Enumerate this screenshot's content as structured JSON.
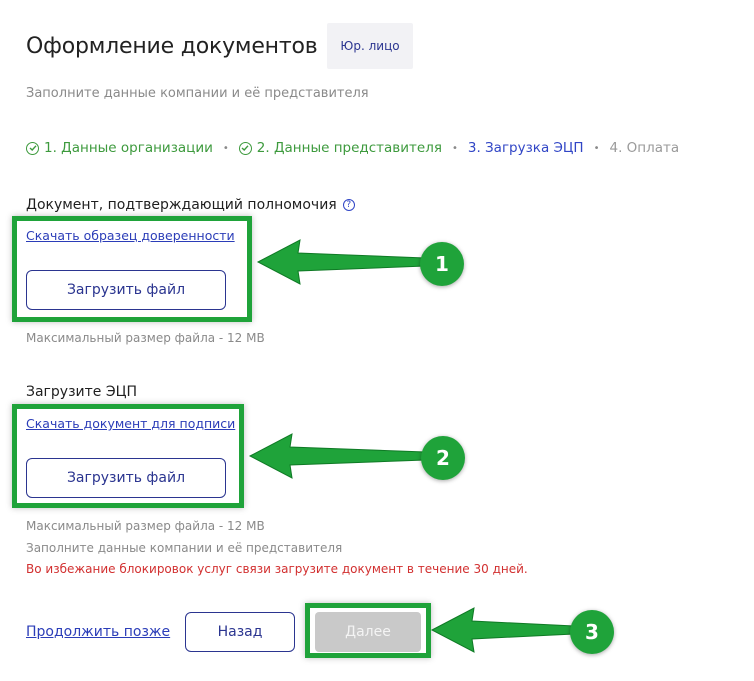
{
  "header": {
    "title": "Оформление документов",
    "badge": "Юр. лицо",
    "subtitle": "Заполните данные компании и её представителя"
  },
  "steps": [
    {
      "label": "1. Данные организации",
      "state": "done"
    },
    {
      "label": "2. Данные представителя",
      "state": "done"
    },
    {
      "label": "3. Загрузка ЭЦП",
      "state": "active"
    },
    {
      "label": "4. Оплата",
      "state": "todo"
    }
  ],
  "section1": {
    "label": "Документ, подтверждающий полномочия",
    "help_icon": "?",
    "link": "Скачать образец доверенности",
    "upload": "Загрузить файл",
    "hint": "Максимальный размер файла - 12 MB"
  },
  "section2": {
    "label": "Загрузите ЭЦП",
    "link": "Скачать документ для подписи",
    "upload": "Загрузить файл",
    "hint": "Максимальный размер файла - 12 MB",
    "hint2": "Заполните данные компании и её представителя",
    "warning": "Во избежание блокировок услуг связи загрузите документ в течение 30 дней."
  },
  "actions": {
    "later": "Продолжить позже",
    "back": "Назад",
    "next": "Далее"
  },
  "annotations": [
    "1",
    "2",
    "3"
  ],
  "colors": {
    "accent": "#2b3590",
    "link": "#2b3db8",
    "done": "#3d9a3d",
    "highlight": "#1fa33a",
    "warning": "#d23030"
  }
}
